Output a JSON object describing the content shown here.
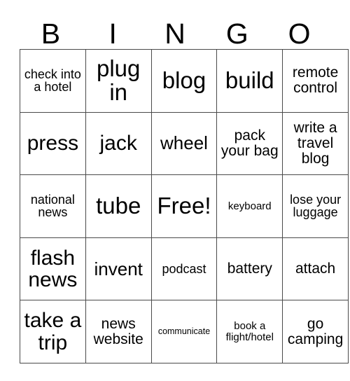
{
  "card": {
    "header_letters": [
      "B",
      "I",
      "N",
      "G",
      "O"
    ],
    "free_space_label": "Free!",
    "rows": [
      [
        {
          "text": "check into a hotel",
          "size": "fs-s"
        },
        {
          "text": "plug in",
          "size": "fs-xxl"
        },
        {
          "text": "blog",
          "size": "fs-xxl"
        },
        {
          "text": "build",
          "size": "fs-xxl"
        },
        {
          "text": "remote control",
          "size": "fs-m"
        }
      ],
      [
        {
          "text": "press",
          "size": "fs-xl"
        },
        {
          "text": "jack",
          "size": "fs-xl"
        },
        {
          "text": "wheel",
          "size": "fs-l"
        },
        {
          "text": "pack your bag",
          "size": "fs-m"
        },
        {
          "text": "write a travel blog",
          "size": "fs-m"
        }
      ],
      [
        {
          "text": "national news",
          "size": "fs-s"
        },
        {
          "text": "tube",
          "size": "fs-xxl"
        },
        {
          "text": "Free!",
          "size": "fs-xxl"
        },
        {
          "text": "keyboard",
          "size": "fs-xs"
        },
        {
          "text": "lose your luggage",
          "size": "fs-s"
        }
      ],
      [
        {
          "text": "flash news",
          "size": "fs-xl"
        },
        {
          "text": "invent",
          "size": "fs-l"
        },
        {
          "text": "podcast",
          "size": "fs-s"
        },
        {
          "text": "battery",
          "size": "fs-m"
        },
        {
          "text": "attach",
          "size": "fs-m"
        }
      ],
      [
        {
          "text": "take a trip",
          "size": "fs-xl"
        },
        {
          "text": "news website",
          "size": "fs-m"
        },
        {
          "text": "communicate",
          "size": "fs-xxs"
        },
        {
          "text": "book a flight/hotel",
          "size": "fs-xs"
        },
        {
          "text": "go camping",
          "size": "fs-m"
        }
      ]
    ]
  }
}
